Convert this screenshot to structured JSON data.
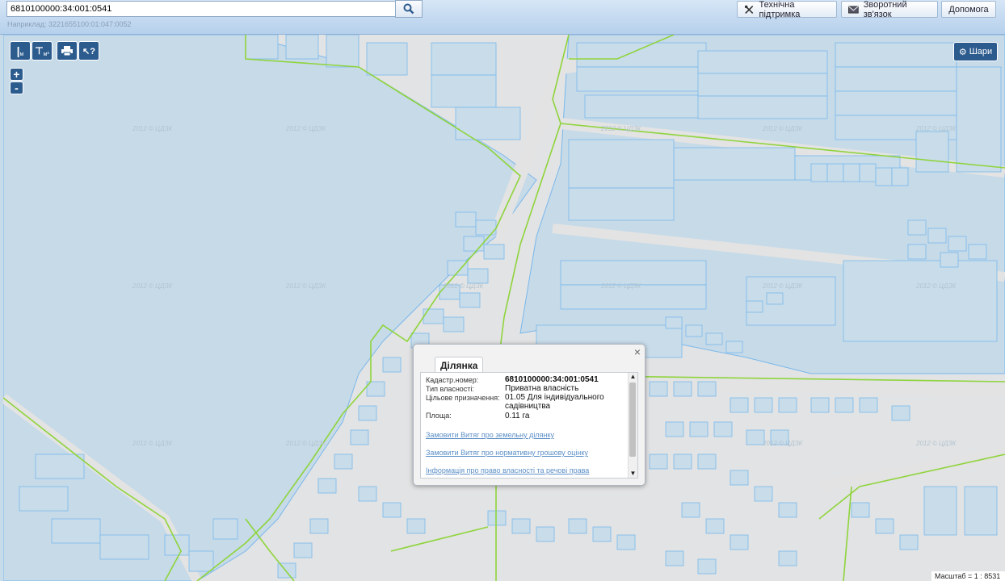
{
  "search": {
    "value": "6810100000:34:001:0541",
    "hint": "Наприклад: 3221655100:01:047:0052"
  },
  "toolbar": {
    "support_label": "Технічна підтримка",
    "feedback_label": "Зворотний зв'язок",
    "help_label": "Допомога"
  },
  "map_controls": {
    "zoom_in": "+",
    "zoom_out": "-",
    "layers_label": "Шари",
    "measure_length_unit": "м",
    "measure_area_unit": "м²"
  },
  "watermark": "2012 © ЦДЗК",
  "popup": {
    "tab": "Ділянка",
    "fields": [
      {
        "label": "Кадастр.номер:",
        "value": "6810100000:34:001:0541"
      },
      {
        "label": "Тип власності:",
        "value": "Приватна власність"
      },
      {
        "label": "Цільове призначення:",
        "value": "01.05 Для індивідуального садівництва"
      },
      {
        "label": "Площа:",
        "value": "0.11 га"
      }
    ],
    "links": [
      "Замовити Витяг про земельну ділянку",
      "Замовити Витяг про нормативну грошову оцінку",
      "Інформація про право власності та речові права"
    ],
    "close": "×"
  },
  "scale_text": "Масштаб = 1 : 8531",
  "colors": {
    "parcel_stroke": "#7ab8ec",
    "parcel_fill": "#c7dbe9",
    "boundary": "#8fd43c",
    "road": "#e3e3e3",
    "control": "#2c5b8e"
  }
}
